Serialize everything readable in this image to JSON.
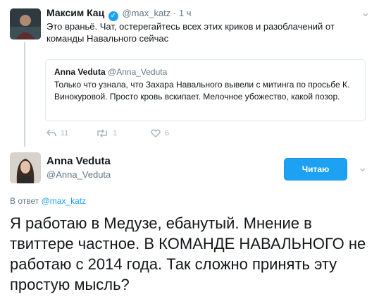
{
  "parent_tweet": {
    "display_name": "Максим Кац",
    "handle": "@max_katz",
    "time": "· 1 ч",
    "text": "Это враньё. Чат, остерегайтесь всех этих криков и разоблачений от команды Навального сейчас",
    "quote": {
      "display_name": "Anna Veduta",
      "handle": "@Anna_Veduta",
      "text": "Только что узнала, что Захара Навального вывели с митинга по просьбе К. Винокуровой. Просто кровь вскипает. Мелочное убожество, какой позор."
    },
    "actions": {
      "replies": "11",
      "retweets": "1",
      "likes": "6"
    }
  },
  "reply_tweet": {
    "display_name": "Anna Veduta",
    "handle": "@Anna_Veduta",
    "follow_label": "Читаю",
    "reply_prefix": "В ответ",
    "reply_handle": "@max_katz",
    "text": "Я работаю в Медузе, ебанутый. Мнение в твиттере частное. В КОМАНДЕ НАВАЛЬНОГО не работаю с 2014 года. Так сложно принять эту простую мысль?"
  },
  "colors": {
    "accent": "#1da1f2",
    "muted": "#657786",
    "border": "#e1e8ed"
  },
  "icons": [
    "reply-icon",
    "retweet-icon",
    "like-icon",
    "verified-icon",
    "chevron-down-icon"
  ]
}
